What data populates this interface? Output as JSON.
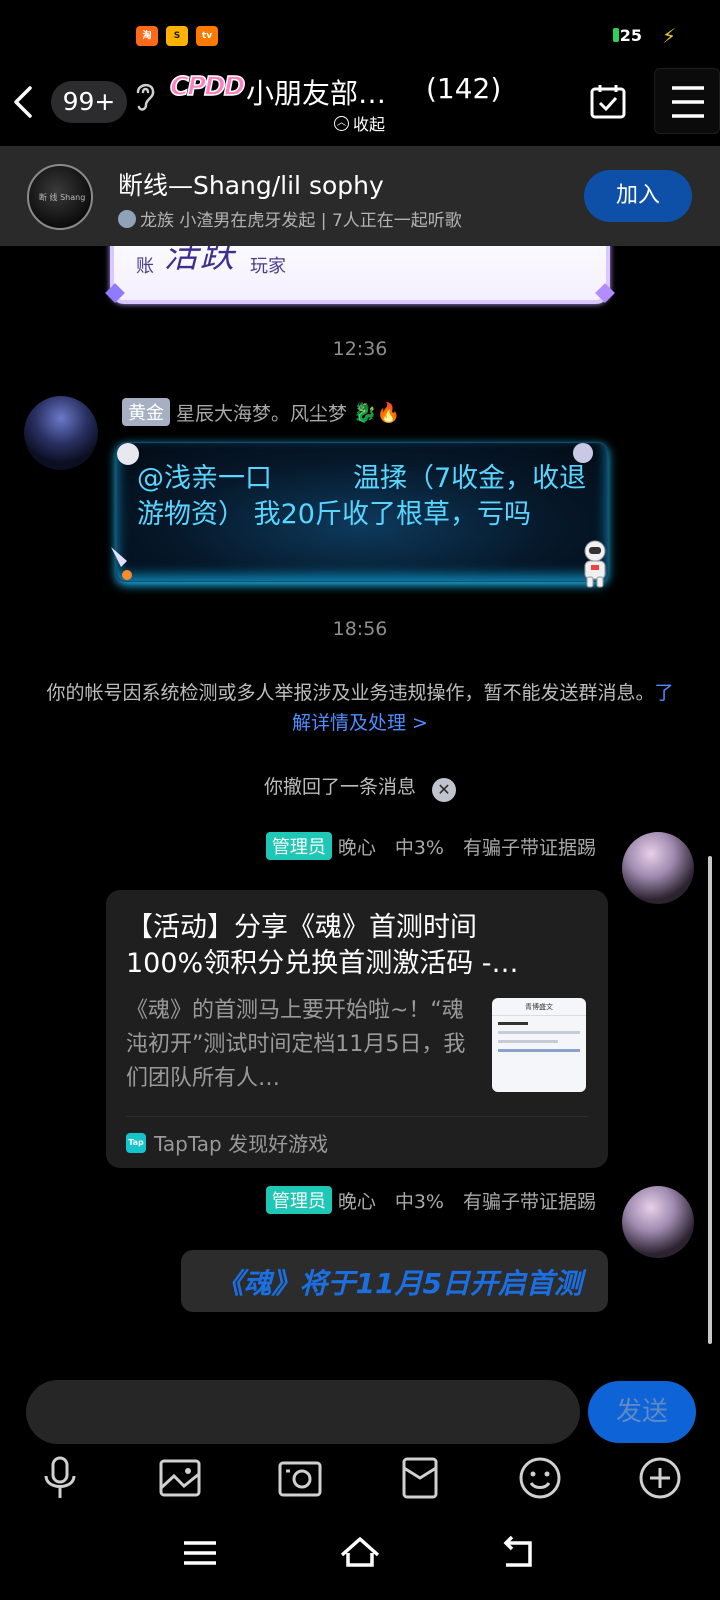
{
  "status_bar": {
    "apps": [
      {
        "icon": "taobao-app-icon",
        "label": "淘",
        "color": "#ff6a1a"
      },
      {
        "icon": "shop-app-icon",
        "label": "S",
        "color": "#ffb300"
      },
      {
        "icon": "video-app-icon",
        "label": "tv",
        "color": "#ff7a00"
      }
    ],
    "battery": "25"
  },
  "header": {
    "back_icon": "chevron-left-icon",
    "unread_count": "99+",
    "group_logo": "CPDD",
    "group_name": "小朋友部…",
    "member_count": "(142)",
    "collapse_label": "收起"
  },
  "listen_banner": {
    "avatar_text": "断 线 Shang",
    "title": "断线—Shang/lil sophy",
    "subtitle": "龙族 小渣男在虎牙发起 | 7人正在一起听歌",
    "join_label": "加入"
  },
  "chat": {
    "badge_card": {
      "small_left": "账",
      "big": "活跃",
      "small_right": "玩家"
    },
    "time_1": "12:36",
    "msg_1": {
      "tag": "黄金",
      "sender": "星辰大海梦。风尘梦",
      "emoji": "🐉🔥",
      "text": "@浅亲一口　　　温揉（7收金，收退游物资） 我20斤收了根草，亏吗"
    },
    "time_2": "18:56",
    "system_notice": "你的帐号因系统检测或多人举报涉及业务违规操作，暂不能发送群消息。",
    "system_link": "了解详情及处理 >",
    "recall_text": "你撤回了一条消息",
    "msg_2": {
      "tag": "管理员",
      "sender": "晚心　中3%　有骗子带证据踢",
      "card_title_line1": "【活动】分享《魂》首测时间",
      "card_title_line2": "100%领积分兑换首测激活码 -…",
      "card_desc": "《魂》的首测马上要开始啦~！“魂沌初开”测试时间定档11月5日，我们团队所有人…",
      "thumb_header": "青博盛文",
      "source": "TapTap 发现好游戏",
      "source_logo": "Tap"
    },
    "msg_3": {
      "tag": "管理员",
      "sender": "晚心　中3%　有骗子带证据踢",
      "text": "《魂》将于11月5日开启首测"
    }
  },
  "input": {
    "placeholder": "",
    "send_label": "发送"
  },
  "toolbar": [
    "microphone-icon",
    "image-icon",
    "camera-icon",
    "red-packet-icon",
    "emoji-icon",
    "plus-icon"
  ],
  "navbar": [
    "menu-icon",
    "home-icon",
    "back-icon"
  ]
}
